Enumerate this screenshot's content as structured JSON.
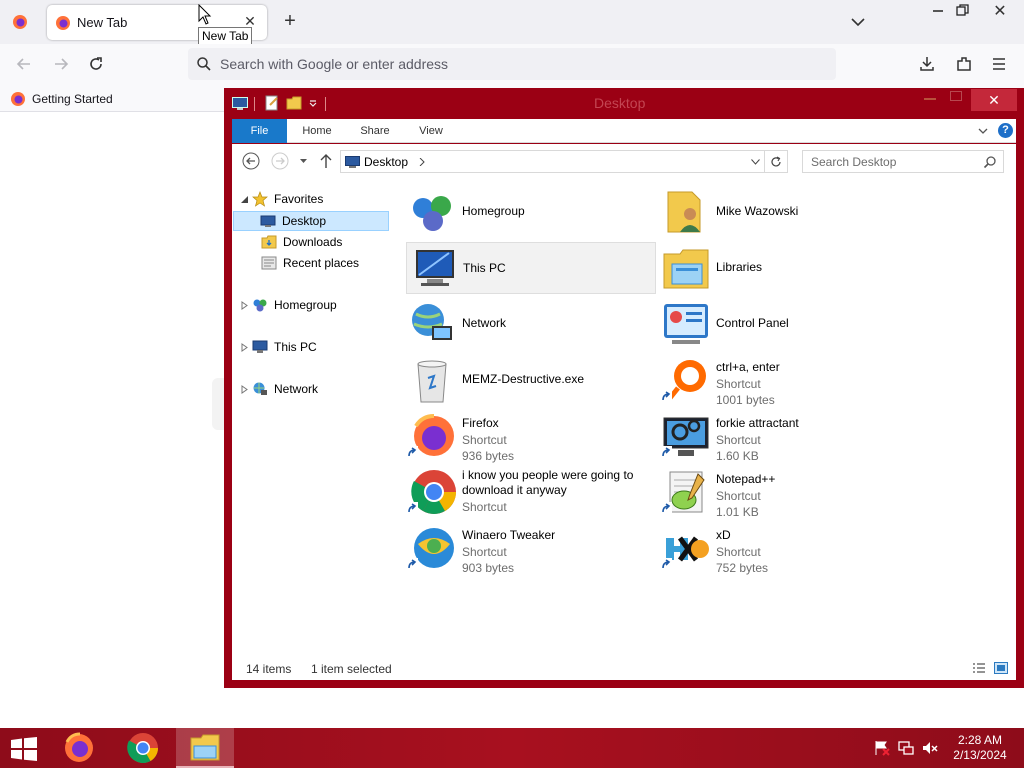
{
  "browser": {
    "tab": {
      "title": "New Tab",
      "tooltip": "New Tab"
    },
    "urlbar": {
      "placeholder": "Search with Google or enter address"
    },
    "bookmarks": [
      {
        "label": "Getting Started"
      }
    ]
  },
  "explorer": {
    "title": "Desktop",
    "ribbon_tabs": {
      "file": "File",
      "home": "Home",
      "share": "Share",
      "view": "View"
    },
    "help": "?",
    "address": {
      "crumb": "Desktop"
    },
    "search": {
      "placeholder": "Search Desktop"
    },
    "nav": {
      "favorites": "Favorites",
      "desktop": "Desktop",
      "downloads": "Downloads",
      "recent": "Recent places",
      "homegroup": "Homegroup",
      "thispc": "This PC",
      "network": "Network"
    },
    "items": {
      "homegroup": {
        "name": "Homegroup"
      },
      "user": {
        "name": "Mike Wazowski"
      },
      "thispc": {
        "name": "This PC"
      },
      "libraries": {
        "name": "Libraries"
      },
      "network": {
        "name": "Network"
      },
      "controlpanel": {
        "name": "Control Panel"
      },
      "memz": {
        "name": "MEMZ-Destructive.exe"
      },
      "ctrla": {
        "name": "ctrl+a, enter",
        "type": "Shortcut",
        "size": "1001 bytes"
      },
      "firefox": {
        "name": "Firefox",
        "type": "Shortcut",
        "size": "936 bytes"
      },
      "forkie": {
        "name": "forkie attractant",
        "type": "Shortcut",
        "size": "1.60 KB"
      },
      "chrome": {
        "name": "i know you people were going to download it anyway",
        "type": "Shortcut"
      },
      "notepadpp": {
        "name": "Notepad++",
        "type": "Shortcut",
        "size": "1.01 KB"
      },
      "winaero": {
        "name": "Winaero Tweaker",
        "type": "Shortcut",
        "size": "903 bytes"
      },
      "xd": {
        "name": "xD",
        "type": "Shortcut",
        "size": "752 bytes"
      }
    },
    "status": {
      "count": "14 items",
      "selected": "1 item selected"
    }
  },
  "taskbar": {
    "time": "2:28 AM",
    "date": "2/13/2024"
  },
  "colors": {
    "accent": "#9b0014",
    "ribbon_file": "#1979ca",
    "selection": "#cce8ff",
    "taskbar": "#a8101f"
  }
}
